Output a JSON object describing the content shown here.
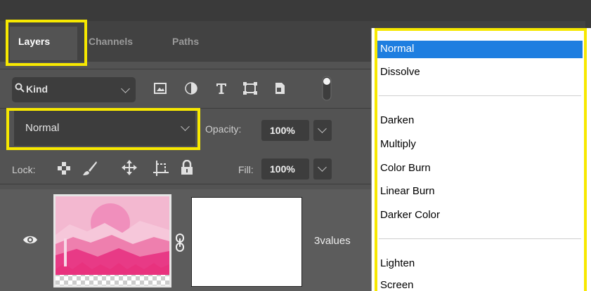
{
  "tabs": [
    {
      "label": "Layers"
    },
    {
      "label": "Channels"
    },
    {
      "label": "Paths"
    }
  ],
  "filter": {
    "kind_label": "Kind",
    "icons": [
      "image-filter-icon",
      "adjustment-filter-icon",
      "type-filter-icon",
      "shape-filter-icon",
      "smart-object-filter-icon",
      "filter-toggle-icon"
    ]
  },
  "blend_mode": {
    "value": "Normal"
  },
  "opacity": {
    "label": "Opacity:",
    "value": "100%"
  },
  "lock": {
    "label": "Lock:",
    "icons": [
      "lock-transparent-pixels-icon",
      "lock-image-pixels-icon",
      "lock-position-icon",
      "lock-artboard-icon",
      "lock-all-icon"
    ]
  },
  "fill": {
    "label": "Fill:",
    "value": "100%"
  },
  "layer": {
    "name": "3values"
  },
  "dropdown": {
    "items": [
      "Normal",
      "Dissolve",
      "Darken",
      "Multiply",
      "Color Burn",
      "Linear Burn",
      "Darker Color",
      "Lighten",
      "Screen"
    ],
    "selected": "Normal"
  },
  "colors": {
    "highlight": "#f7e800",
    "selection": "#1e7ee0",
    "panel": "#535353",
    "field": "#3d3d3d"
  }
}
